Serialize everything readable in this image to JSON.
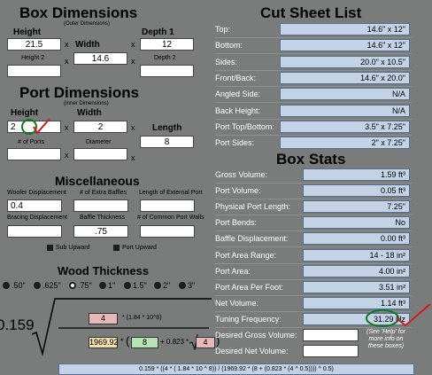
{
  "box": {
    "title": "Box Dimensions",
    "subtitle": "(Outer Dimensions)",
    "height_label": "Height",
    "height": "21.5",
    "width_label": "Width",
    "width": "14.6",
    "depth1_label": "Depth 1",
    "depth1": "12",
    "height2_label": "Height 2",
    "height2": "",
    "depth2_label": "Depth 2",
    "depth2": "",
    "x": "x"
  },
  "port": {
    "title": "Port Dimensions",
    "subtitle": "(Inner Dimensions)",
    "height_label": "Height",
    "height": "2",
    "width_label": "Width",
    "width": "2",
    "length_label": "Length",
    "length": "8",
    "num_ports_label": "# of Ports",
    "num_ports": "",
    "diameter_label": "Diameter",
    "diameter": ""
  },
  "misc": {
    "title": "Miscellaneous",
    "woofer_label": "Woofer Displacement",
    "woofer": "0.4",
    "baffles_label": "# of Extra Baffles",
    "baffles": "",
    "ext_port_label": "Length of External Port",
    "ext_port": "",
    "bracing_label": "Bracing Displacement",
    "bracing": "",
    "baffle_thick_label": "Baffle Thickness",
    "baffle_thick": ".75",
    "common_walls_label": "# of Common Port Walls",
    "common_walls": "",
    "sub_upward": "Sub Upward",
    "port_upward": "Port Upward"
  },
  "wood": {
    "title": "Wood Thickness",
    "options": [
      ".50\"",
      ".625\"",
      ".75\"",
      "1\"",
      "1.5\"",
      "2\"",
      "3\""
    ],
    "selected": ".75\""
  },
  "formula": {
    "coef": "0.159",
    "num_a": "4",
    "num_rest": "* (1.84 * 10^8)",
    "den_a": "1969.92",
    "den_star": "*",
    "den_paren": "(",
    "den_b": "8",
    "den_plus": "+ 0.823 *",
    "den_c": "4",
    "den_close": ")",
    "expression": "0.159 * ((4 * ( 1.84 * 10 ^ 8)) / (1969.92 * (8 + (0.823 * (4 ^ 0.5)))) ^ 0.5)"
  },
  "cut_sheet": {
    "title": "Cut Sheet List",
    "rows": [
      {
        "label": "Top:",
        "value": "14.6\" x 12\""
      },
      {
        "label": "Bottom:",
        "value": "14.6\" x 12\""
      },
      {
        "label": "Sides:",
        "value": "20.0\" x 10.5\""
      },
      {
        "label": "Front/Back:",
        "value": "14.6\" x 20.0\""
      },
      {
        "label": "Angled Side:",
        "value": "N/A"
      },
      {
        "label": "Back Height:",
        "value": "N/A"
      },
      {
        "label": "Port Top/Bottom:",
        "value": "3.5\" x 7.25\""
      },
      {
        "label": "Port Sides:",
        "value": "2\" x 7.25\""
      }
    ]
  },
  "box_stats": {
    "title": "Box Stats",
    "rows": [
      {
        "label": "Gross Volume:",
        "value": "1.59 ft³"
      },
      {
        "label": "Port Volume:",
        "value": "0.05 ft³"
      },
      {
        "label": "Physical Port Length:",
        "value": "7.25\""
      },
      {
        "label": "Port Bends:",
        "value": "No"
      },
      {
        "label": "Baffle Displacement:",
        "value": "0.00 ft³"
      },
      {
        "label": "Port Area Range:",
        "value": "14 - 18 in²"
      },
      {
        "label": "Port Area:",
        "value": "4.00 in²"
      },
      {
        "label": "Port Area Per Foot:",
        "value": "3.51 in²"
      },
      {
        "label": "Net Volume:",
        "value": "1.14 ft³"
      },
      {
        "label": "Tuning Frequency:",
        "value": "31.29 Hz"
      }
    ],
    "desired_gross_label": "Desired Gross Volume:",
    "desired_gross": "",
    "desired_net_label": "Desired Net Volume:",
    "desired_net": "",
    "help_note": "(See 'Help' for more info on these boxes)"
  }
}
